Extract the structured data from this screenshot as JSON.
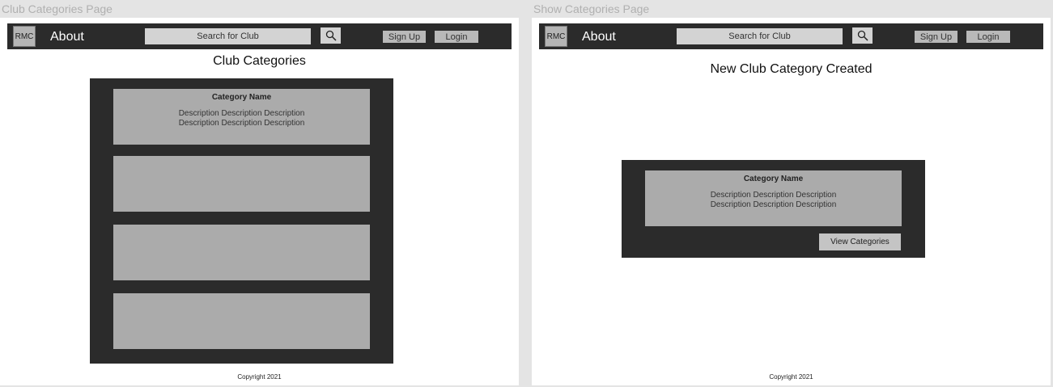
{
  "frames": [
    {
      "label": "Club Categories Page",
      "nav": {
        "logo": "RMC",
        "about": "About",
        "search_placeholder": "Search for Club",
        "signup": "Sign Up",
        "login": "Login"
      },
      "title": "Club Categories",
      "cards": [
        {
          "name": "Category Name",
          "desc_line1": "Description Description Description",
          "desc_line2": "Description Description Description"
        },
        {
          "name": "",
          "desc_line1": "",
          "desc_line2": ""
        },
        {
          "name": "",
          "desc_line1": "",
          "desc_line2": ""
        },
        {
          "name": "",
          "desc_line1": "",
          "desc_line2": ""
        }
      ],
      "footer": "Copyright 2021"
    },
    {
      "label": "Show Categories Page",
      "nav": {
        "logo": "RMC",
        "about": "About",
        "search_placeholder": "Search for Club",
        "signup": "Sign Up",
        "login": "Login"
      },
      "title": "New Club Category Created",
      "card": {
        "name": "Category Name",
        "desc_line1": "Description Description Description",
        "desc_line2": "Description Description Description"
      },
      "view_button": "View Categories",
      "footer": "Copyright 2021"
    }
  ],
  "icons": {
    "search": "search-icon"
  },
  "colors": {
    "navbar": "#2b2b2b",
    "panel": "#2b2b2b",
    "card": "#ababab",
    "button": "#c4c4c4"
  }
}
